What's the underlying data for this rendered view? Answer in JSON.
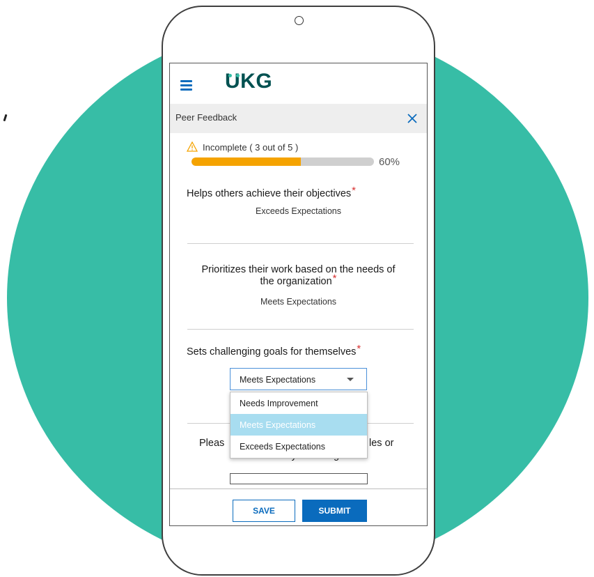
{
  "app": {
    "logo_text": "UKG",
    "brand_color": "#005151",
    "accent_color": "#37bda6"
  },
  "titlebar": {
    "title": "Peer Feedback",
    "close_icon": "close-icon"
  },
  "progress": {
    "status_text": "Incomplete ( 3 out of 5 )",
    "percent_label": "60%",
    "fraction": 0.6,
    "fill_color": "#f5a300",
    "status_icon": "warning-icon"
  },
  "questions": [
    {
      "label": "Helps others achieve their objectives",
      "required_mark": "*",
      "value": "Exceeds Expectations"
    },
    {
      "label_line1": "Prioritizes their work based on the needs of",
      "label_line2": "the organization",
      "required_mark": "*",
      "value": "Meets Expectations"
    },
    {
      "label": "Sets challenging goals for themselves",
      "required_mark": "*",
      "selected": "Meets Expectations"
    }
  ],
  "dropdown": {
    "options": [
      "Needs Improvement",
      "Meets Expectations",
      "Exceeds Expectations"
    ],
    "highlighted_index": 1
  },
  "partial_question": {
    "visible_left": "Pleas",
    "visible_right": "les or",
    "visible_line2": "rationale for your rating."
  },
  "footer": {
    "save_label": "SAVE",
    "submit_label": "SUBMIT"
  }
}
